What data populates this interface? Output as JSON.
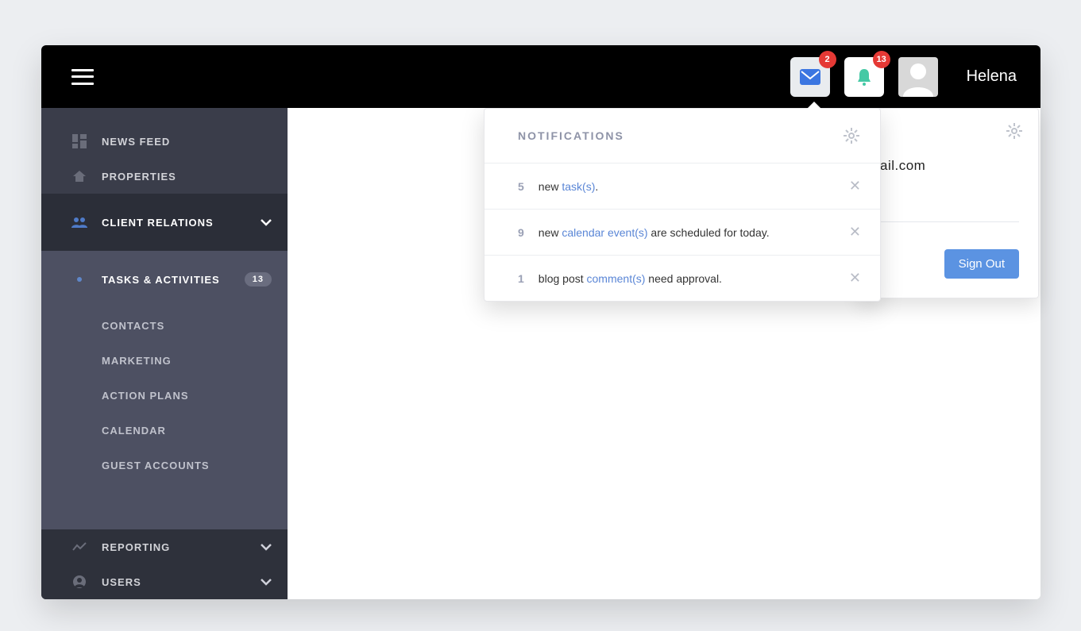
{
  "topbar": {
    "mail_badge": "2",
    "bell_badge": "13",
    "username": "Helena"
  },
  "sidebar": {
    "news_feed": "NEWS FEED",
    "properties": "PROPERTIES",
    "client_relations": "CLIENT RELATIONS",
    "tasks": "TASKS & ACTIVITIES",
    "tasks_badge": "13",
    "contacts": "CONTACTS",
    "marketing": "MARKETING",
    "action_plans": "ACTION PLANS",
    "calendar": "CALENDAR",
    "guest_accounts": "GUEST ACCOUNTS",
    "reporting": "REPORTING",
    "users": "USERS"
  },
  "notifications": {
    "title": "NOTIFICATIONS",
    "items": [
      {
        "count": "5",
        "pre": "new ",
        "link": "task(s)",
        "post": "."
      },
      {
        "count": "9",
        "pre": "new ",
        "link": "calendar event(s)",
        "post": " are scheduled for today."
      },
      {
        "count": "1",
        "pre": "blog post ",
        "link": "comment(s)",
        "post": " need approval."
      }
    ]
  },
  "profile": {
    "email_suffix": "ail.com",
    "signout": "Sign Out"
  },
  "icons": {
    "menu": "menu-icon",
    "mail": "mail-icon",
    "bell": "bell-icon",
    "avatar": "avatar-icon",
    "dashboard": "dashboard-icon",
    "home": "home-icon",
    "people": "people-icon",
    "chart": "chart-icon",
    "user_circle": "user-circle-icon",
    "gear": "gear-icon",
    "close": "close-icon",
    "chevron_down": "chevron-down-icon"
  }
}
